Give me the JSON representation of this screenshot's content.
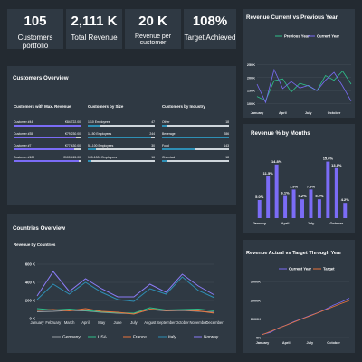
{
  "kpis": [
    {
      "value": "105",
      "label": "Customers portfolio"
    },
    {
      "value": "2,111 K",
      "label": "Total Revenue"
    },
    {
      "value": "20 K",
      "label": "Revenue per customer"
    },
    {
      "value": "108%",
      "label": "Target Achieved"
    }
  ],
  "customers": {
    "title": "Customers Overview",
    "groups": [
      {
        "title": "Customers with Max. Revenue",
        "color": "#7b6cf6",
        "rows": [
          {
            "name": "Customer #44",
            "value": "€84,722.00",
            "pct": 1.0
          },
          {
            "name": "Customer #35",
            "value": "€79,230.00",
            "pct": 0.93
          },
          {
            "name": "Customer #7",
            "value": "€77,430.00",
            "pct": 0.91
          },
          {
            "name": "Customer #100",
            "value": "€100,415.00",
            "pct": 0.97
          }
        ]
      },
      {
        "title": "Customers by Size",
        "color": "#2e8fb5",
        "rows": [
          {
            "name": "1-10 Employees",
            "value": "47",
            "pct": 0.18
          },
          {
            "name": "11-50 Employees",
            "value": "244",
            "pct": 0.95
          },
          {
            "name": "51-100 Employees",
            "value": "30",
            "pct": 0.12
          },
          {
            "name": "100-1000 Employees",
            "value": "16",
            "pct": 0.06
          }
        ]
      },
      {
        "title": "Customers by Industry",
        "color": "#2e8fb5",
        "rows": [
          {
            "name": "Other",
            "value": "18",
            "pct": 0.07
          },
          {
            "name": "Beverage",
            "value": "286",
            "pct": 1.0
          },
          {
            "name": "Food",
            "value": "143",
            "pct": 0.5
          },
          {
            "name": "Chemical",
            "value": "18",
            "pct": 0.07
          }
        ]
      }
    ]
  },
  "colors": {
    "purple": "#7b6cf6",
    "green": "#2fbf8a",
    "blue": "#2e8fb5",
    "orange": "#e8743b"
  },
  "chart_data": [
    {
      "id": "rev_prev",
      "type": "line",
      "title": "Revenue Current vs Previous Year",
      "categories": [
        "Jan",
        "Feb",
        "Mar",
        "April",
        "May",
        "Jun",
        "July",
        "Aug",
        "Sep",
        "October",
        "Nov",
        "Dec"
      ],
      "xticks": [
        {
          "i": 0,
          "label": "January"
        },
        {
          "i": 3,
          "label": "April"
        },
        {
          "i": 6,
          "label": "July"
        },
        {
          "i": 9,
          "label": "October"
        }
      ],
      "yticks": [
        {
          "v": 100,
          "label": "100K"
        },
        {
          "v": 150,
          "label": "150K"
        },
        {
          "v": 200,
          "label": "200K"
        },
        {
          "v": 250,
          "label": "250K"
        }
      ],
      "ylim": [
        85,
        265
      ],
      "series": [
        {
          "name": "Previous Year",
          "color": "#2fbf8a",
          "values": [
            128,
            112,
            188,
            195,
            145,
            178,
            168,
            150,
            208,
            190,
            225,
            175
          ]
        },
        {
          "name": "Current Year",
          "color": "#7b6cf6",
          "values": [
            175,
            105,
            230,
            158,
            185,
            160,
            170,
            150,
            190,
            220,
            168,
            110
          ]
        }
      ]
    },
    {
      "id": "rev_pct",
      "type": "bar",
      "title": "Revenue % by Months",
      "values": [
        5.0,
        11.5,
        14.8,
        6.1,
        7.9,
        5.2,
        7.9,
        5.2,
        15.6,
        13.8,
        4.2
      ],
      "labels": [
        "5.0%",
        "11.5%",
        "14.8%",
        "6.1%",
        "7.9%",
        "5.2%",
        "7.9%",
        "5.2%",
        "15.6%",
        "13.8%",
        "4.2%"
      ],
      "categories": [
        "January",
        "Feb",
        "Mar",
        "April",
        "May",
        "Jun",
        "July",
        "Aug",
        "Sep",
        "October",
        "Nov"
      ],
      "xticks": [
        {
          "i": 0,
          "label": "January"
        },
        {
          "i": 3,
          "label": "April"
        },
        {
          "i": 6,
          "label": "July"
        },
        {
          "i": 9,
          "label": "October"
        }
      ],
      "ylim": [
        0,
        18
      ],
      "color": "#7b6cf6"
    },
    {
      "id": "countries",
      "type": "line",
      "title": "Countries Overview",
      "subtitle": "Revenue by Countries",
      "categories": [
        "January",
        "February",
        "March",
        "April",
        "May",
        "June",
        "July",
        "August",
        "September",
        "October",
        "November",
        "December"
      ],
      "yticks": [
        {
          "v": 0,
          "label": "0 K"
        },
        {
          "v": 200,
          "label": "200 K"
        },
        {
          "v": 400,
          "label": "400 K"
        },
        {
          "v": 600,
          "label": "600 K"
        }
      ],
      "ylim": [
        0,
        650
      ],
      "series": [
        {
          "name": "Germany",
          "color": "#9aa0a6",
          "values": [
            75,
            80,
            90,
            85,
            70,
            60,
            55,
            100,
            85,
            90,
            80,
            70
          ]
        },
        {
          "name": "USA",
          "color": "#2fbf8a",
          "values": [
            110,
            95,
            105,
            90,
            75,
            65,
            60,
            120,
            95,
            100,
            105,
            85
          ]
        },
        {
          "name": "France",
          "color": "#e8743b",
          "values": [
            90,
            100,
            85,
            110,
            80,
            70,
            50,
            105,
            90,
            95,
            85,
            60
          ]
        },
        {
          "name": "Italy",
          "color": "#2e8fb5",
          "values": [
            210,
            380,
            270,
            400,
            290,
            210,
            190,
            330,
            270,
            460,
            310,
            230
          ]
        },
        {
          "name": "Norway",
          "color": "#8b7cf7",
          "values": [
            250,
            520,
            300,
            440,
            330,
            240,
            240,
            380,
            290,
            490,
            360,
            260
          ]
        }
      ]
    },
    {
      "id": "rev_target",
      "type": "line",
      "title": "Revenue Actual vs Target Through Year",
      "categories": [
        "Jan",
        "Feb",
        "Mar",
        "April",
        "May",
        "Jun",
        "July",
        "Aug",
        "Sep",
        "October",
        "Nov",
        "Dec"
      ],
      "xticks": [
        {
          "i": 0,
          "label": "January"
        },
        {
          "i": 3,
          "label": "April"
        },
        {
          "i": 6,
          "label": "July"
        },
        {
          "i": 9,
          "label": "October"
        }
      ],
      "yticks": [
        {
          "v": 0,
          "label": "0K"
        },
        {
          "v": 1000,
          "label": "1000K"
        },
        {
          "v": 2000,
          "label": "2000K"
        },
        {
          "v": 3000,
          "label": "3000K"
        }
      ],
      "ylim": [
        0,
        3200
      ],
      "series": [
        {
          "name": "Current Year",
          "color": "#7b6cf6",
          "values": [
            175,
            280,
            510,
            668,
            853,
            1013,
            1183,
            1333,
            1523,
            1743,
            1911,
            2111
          ]
        },
        {
          "name": "Target",
          "color": "#e8743b",
          "values": [
            160,
            330,
            500,
            660,
            830,
            1000,
            1160,
            1330,
            1490,
            1660,
            1830,
            1990
          ]
        }
      ]
    }
  ]
}
